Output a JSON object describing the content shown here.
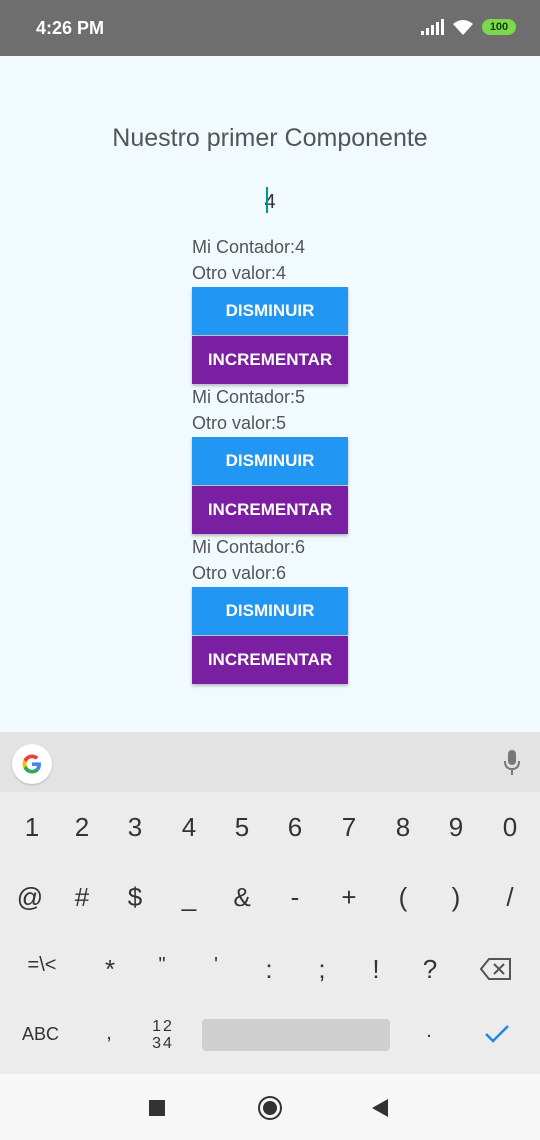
{
  "status_bar": {
    "time": "4:26 PM",
    "battery": "100"
  },
  "app": {
    "title": "Nuestro primer Componente",
    "input_value": "4",
    "counters": [
      {
        "contador": "Mi Contador:4",
        "otro": "Otro valor:4",
        "dec_label": "DISMINUIR",
        "inc_label": "INCREMENTAR"
      },
      {
        "contador": "Mi Contador:5",
        "otro": "Otro valor:5",
        "dec_label": "DISMINUIR",
        "inc_label": "INCREMENTAR"
      },
      {
        "contador": "Mi Contador:6",
        "otro": "Otro valor:6",
        "dec_label": "DISMINUIR",
        "inc_label": "INCREMENTAR"
      }
    ],
    "colors": {
      "decrement": "#2196f3",
      "increment": "#7b1fa2",
      "caret": "#009688"
    }
  },
  "keyboard": {
    "row1": [
      "1",
      "2",
      "3",
      "4",
      "5",
      "6",
      "7",
      "8",
      "9",
      "0"
    ],
    "row2": [
      "@",
      "#",
      "$",
      "_",
      "&",
      "-",
      "+",
      "(",
      ")",
      "/"
    ],
    "row3": [
      "=\\<",
      "*",
      "\"",
      "'",
      ":",
      ";",
      "!",
      "?"
    ],
    "abc_label": "ABC",
    "comma": ",",
    "numswitch_top": "12",
    "numswitch_bottom": "34",
    "period": "."
  }
}
